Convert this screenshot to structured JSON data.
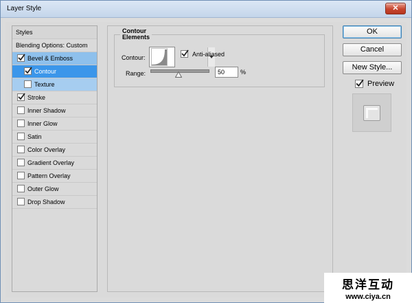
{
  "window": {
    "title": "Layer Style",
    "close_label": "✕"
  },
  "styles_list": {
    "items": [
      {
        "label": "Styles",
        "type": "header"
      },
      {
        "label": "Blending Options: Custom",
        "type": "plain"
      },
      {
        "label": "Bevel & Emboss",
        "checked": true,
        "state": "selected"
      },
      {
        "label": "Contour",
        "checked": true,
        "state": "active"
      },
      {
        "label": "Texture",
        "checked": false,
        "state": "subselected"
      },
      {
        "label": "Stroke",
        "checked": true
      },
      {
        "label": "Inner Shadow",
        "checked": false
      },
      {
        "label": "Inner Glow",
        "checked": false
      },
      {
        "label": "Satin",
        "checked": false
      },
      {
        "label": "Color Overlay",
        "checked": false
      },
      {
        "label": "Gradient Overlay",
        "checked": false
      },
      {
        "label": "Pattern Overlay",
        "checked": false
      },
      {
        "label": "Outer Glow",
        "checked": false
      },
      {
        "label": "Drop Shadow",
        "checked": false
      }
    ]
  },
  "panel": {
    "group_title": "Contour",
    "elements_title": "Elements",
    "contour_label": "Contour:",
    "anti_aliased_label": "Anti-aliased",
    "anti_aliased_checked": true,
    "range_label": "Range:",
    "range_value": "50",
    "range_unit": "%",
    "range_percent": 50
  },
  "buttons": {
    "ok": "OK",
    "cancel": "Cancel",
    "new_style": "New Style...",
    "preview_label": "Preview",
    "preview_checked": true
  },
  "watermark": {
    "line1": "思洋互动",
    "line2": "www.ciya.cn"
  },
  "colors": {
    "selected_row": "#8ec0ec",
    "active_row": "#3b96ea",
    "dialog_bg": "#dadada"
  }
}
